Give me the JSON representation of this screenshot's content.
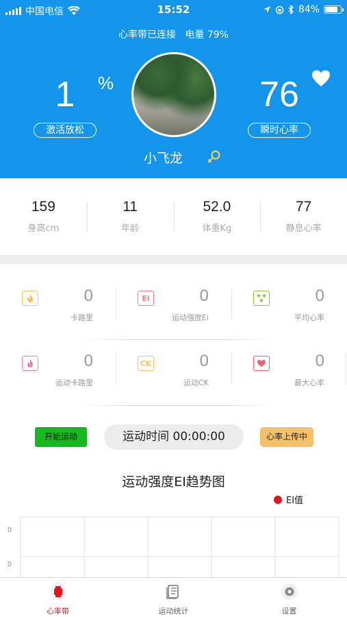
{
  "status_bar": {
    "carrier": "中国电信",
    "time": "15:52",
    "battery": "84%",
    "battery_level": 0.84
  },
  "header": {
    "connection": "心率带已连接",
    "battery_text": "电量 79%",
    "activation_value": "1",
    "activation_unit": "%",
    "activation_label": "激活放松",
    "heart_rate_value": "76",
    "heart_rate_label": "瞬时心率",
    "username": "小飞龙"
  },
  "stats": [
    {
      "value": "159",
      "label": "身高cm"
    },
    {
      "value": "11",
      "label": "年龄"
    },
    {
      "value": "52.0",
      "label": "体重Kg"
    },
    {
      "value": "77",
      "label": "静息心率"
    }
  ],
  "metrics": [
    {
      "value": "0",
      "label": "卡路里",
      "icon": "flame-icon",
      "icon_text": "",
      "color": "#f3c457"
    },
    {
      "value": "0",
      "label": "运动强度Ei",
      "icon": "ei-icon",
      "icon_text": "Ei",
      "color": "#ef7f7f"
    },
    {
      "value": "0",
      "label": "平均心率",
      "icon": "hearts-icon",
      "icon_text": "",
      "color": "#8cc63e"
    },
    {
      "value": "0",
      "label": "运动卡路里",
      "icon": "flame-pink-icon",
      "icon_text": "",
      "color": "#f07ab4"
    },
    {
      "value": "0",
      "label": "运动CK",
      "icon": "ck-icon",
      "icon_text": "CK",
      "color": "#f3c457"
    },
    {
      "value": "0",
      "label": "最大心率",
      "icon": "heart-box-icon",
      "icon_text": "",
      "color": "#ef5f73"
    }
  ],
  "controls": {
    "start_label": "开始运动",
    "time_label": "运动时间 00:00:00",
    "upload_label": "心率上传中"
  },
  "chart_data": {
    "type": "line",
    "title": "运动强度EI趋势图",
    "series": [
      {
        "name": "EI值",
        "values": []
      }
    ],
    "y_tick_labels": [
      "0",
      "0"
    ],
    "grid": true,
    "legend_position": "top-right",
    "colors": {
      "series": "#e4141e"
    }
  },
  "tabs": [
    {
      "label": "心率带",
      "icon": "heart-band-icon",
      "active": true
    },
    {
      "label": "运动统计",
      "icon": "stats-list-icon",
      "active": false
    },
    {
      "label": "设置",
      "icon": "gear-icon",
      "active": false
    }
  ],
  "colors": {
    "header_bg": "#1495ec",
    "active_tab": "#e4141e"
  }
}
